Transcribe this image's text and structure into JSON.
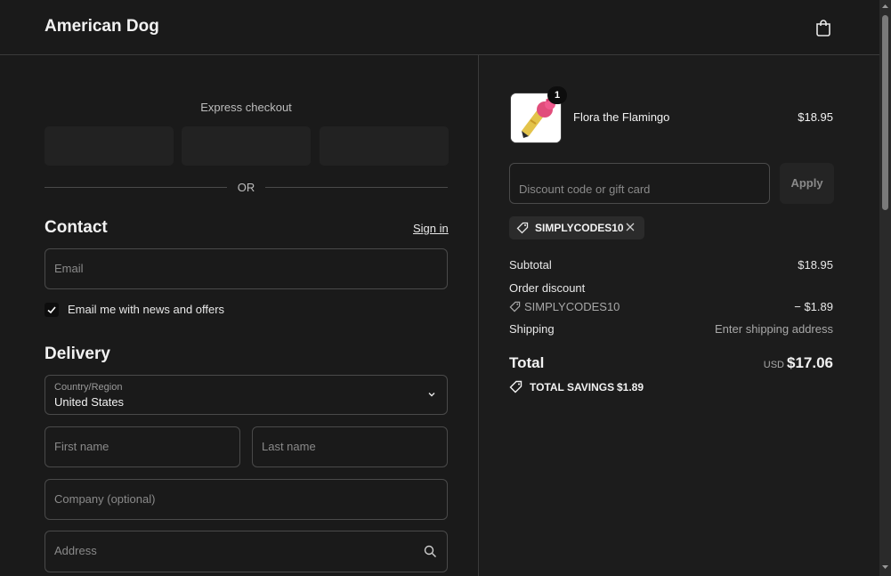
{
  "header": {
    "brand": "American Dog",
    "cart_icon": "shopping-bag-icon"
  },
  "express": {
    "title": "Express checkout",
    "or": "OR"
  },
  "contact": {
    "title": "Contact",
    "sign_in": "Sign in",
    "email_placeholder": "Email",
    "newsletter_label": "Email me with news and offers",
    "newsletter_checked": true
  },
  "delivery": {
    "title": "Delivery",
    "country_label": "Country/Region",
    "country_value": "United States",
    "first_name_placeholder": "First name",
    "last_name_placeholder": "Last name",
    "company_placeholder": "Company (optional)",
    "address_placeholder": "Address"
  },
  "summary": {
    "item": {
      "name": "Flora the Flamingo",
      "price": "$18.95",
      "quantity": "1"
    },
    "discount_placeholder": "Discount code or gift card",
    "apply_label": "Apply",
    "applied_code": "SIMPLYCODES10",
    "subtotal_label": "Subtotal",
    "subtotal_value": "$18.95",
    "order_discount_label": "Order discount",
    "discount_code": "SIMPLYCODES10",
    "discount_value": "− $1.89",
    "shipping_label": "Shipping",
    "shipping_value": "Enter shipping address",
    "total_label": "Total",
    "currency": "USD",
    "total_value": "$17.06",
    "savings_label": "TOTAL SAVINGS",
    "savings_value": "$1.89"
  },
  "colors": {
    "background": "#1a1a1a",
    "border": "#4a4a4a",
    "text": "#e8e8e8"
  }
}
